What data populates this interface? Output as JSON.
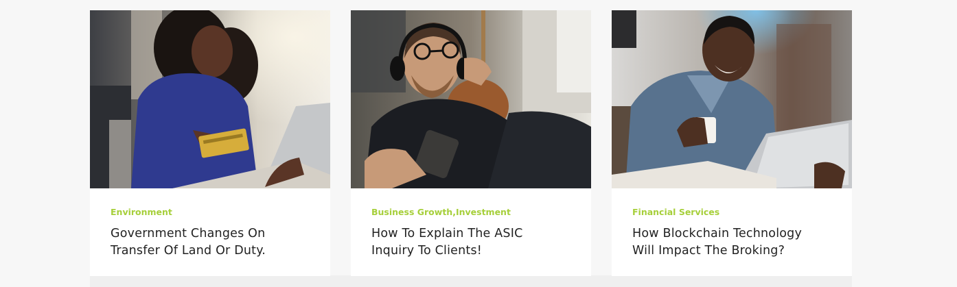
{
  "posts": [
    {
      "category": "Environment",
      "title_line1": "Government Changes On",
      "title_line2": "Transfer Of Land Or Duty.",
      "image_alt": "woman-with-credit-card-and-laptop-photo"
    },
    {
      "category_1": "Business Growth",
      "category_separator": ",",
      "category_2": "Investment",
      "title_line1": "How To Explain The ASIC",
      "title_line2": "Inquiry To Clients!",
      "image_alt": "man-with-headphones-and-phone-photo"
    },
    {
      "category": "Financial Services",
      "title_line1": "How Blockchain Technology",
      "title_line2": "Will Impact The Broking?",
      "image_alt": "man-with-coffee-and-tablet-photo"
    }
  ],
  "colors": {
    "category": "#a6cf3a",
    "title": "#222222",
    "page_bg": "#f7f7f7",
    "card_bg": "#ffffff"
  }
}
